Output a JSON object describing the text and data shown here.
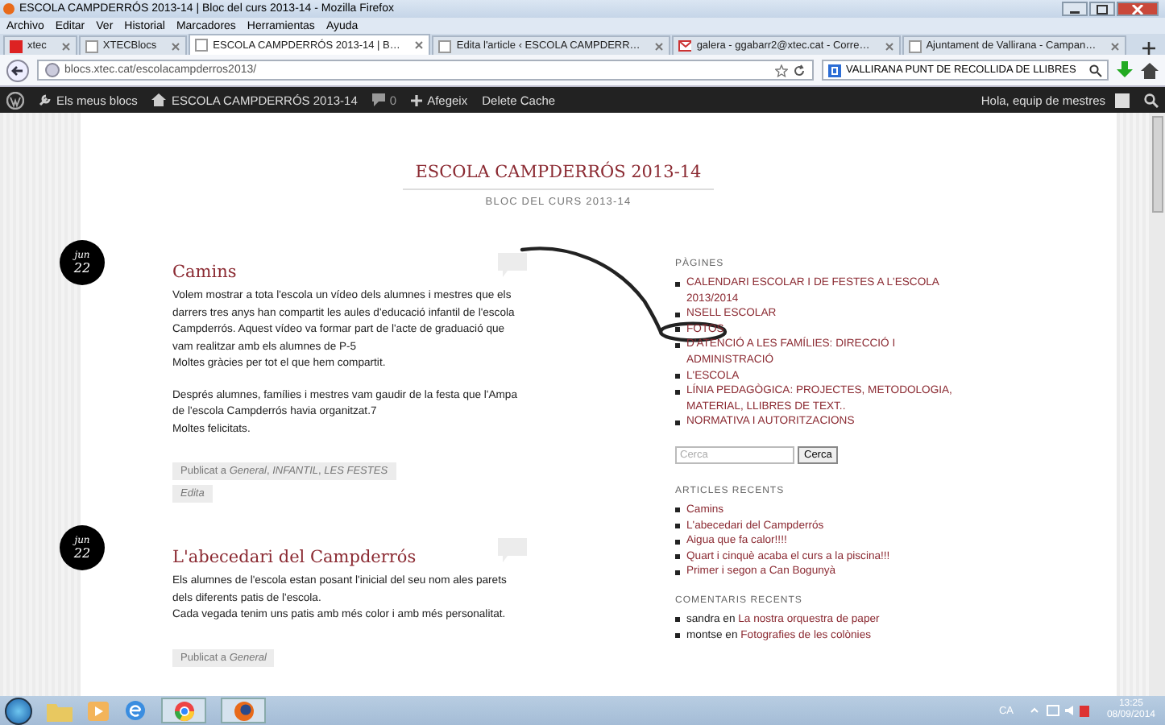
{
  "window": {
    "title": "ESCOLA CAMPDERRÓS 2013-14 | Bloc del curs 2013-14 - Mozilla Firefox"
  },
  "menu": [
    "Archivo",
    "Editar",
    "Ver",
    "Historial",
    "Marcadores",
    "Herramientas",
    "Ayuda"
  ],
  "tabs": [
    {
      "label": "xtec",
      "selected": false,
      "kind": "red"
    },
    {
      "label": "XTECBlocs",
      "selected": false,
      "kind": "page"
    },
    {
      "label": "ESCOLA CAMPDERRÓS 2013-14 | B…",
      "selected": true,
      "kind": "page"
    },
    {
      "label": "Edita l'article ‹ ESCOLA CAMPDERR…",
      "selected": false,
      "kind": "page"
    },
    {
      "label": "galera - ggabarr2@xtec.cat - Corre…",
      "selected": false,
      "kind": "mail"
    },
    {
      "label": "Ajuntament de Vallirana - Campan…",
      "selected": false,
      "kind": "page"
    }
  ],
  "address": {
    "url": "blocs.xtec.cat/escolacampderros2013/"
  },
  "search": {
    "value": "VALLIRANA PUNT DE RECOLLIDA DE LLIBRES"
  },
  "admin_bar": {
    "my_blogs": "Els meus blocs",
    "site": "ESCOLA CAMPDERRÓS 2013-14",
    "comments": "0",
    "add": "Afegeix",
    "cache": "Delete Cache",
    "greeting": "Hola, equip de mestres"
  },
  "blog": {
    "title": "ESCOLA CAMPDERRÓS 2013-14",
    "subtitle": "BLOC DEL CURS 2013-14"
  },
  "posts": [
    {
      "month": "jun",
      "day": "22",
      "title": "Camins",
      "paragraphs": [
        [
          "Volem mostrar a tota l'escola un vídeo dels alumnes i mestres que els darrers tres anys han compartit les aules d'educació infantil de l'escola Campderrós. Aquest vídeo va formar part de l'acte de graduació que vam realitzar amb els alumnes de P-5",
          "Moltes gràcies per tot el que hem compartit."
        ],
        [
          "Després alumnes, famílies i mestres vam gaudir de la festa que l'Ampa de l'escola Campderrós havia organitzat.7",
          "Moltes felicitats."
        ]
      ],
      "categories": "Publicat a *General*, *INFANTIL*, *LES FESTES*",
      "edit": "Edita"
    },
    {
      "month": "jun",
      "day": "22",
      "title": "L'abecedari del Campderrós",
      "paragraphs": [
        [
          "Els alumnes de l'escola estan posant l'inicial del seu nom ales parets dels diferents patis de l'escola.",
          "Cada vegada tenim uns patis amb més color i amb més personalitat."
        ]
      ],
      "categories": "Publicat a *General*"
    }
  ],
  "sidebar": {
    "pages_heading": "PÀGINES",
    "pages": [
      "CALENDARI ESCOLAR I DE FESTES A L'ESCOLA 2013/2014",
      "NSELL ESCOLAR",
      "FOTOS",
      "D'ATENCIÓ A LES FAMÍLIES: DIRECCIÓ I ADMINISTRACIÓ",
      "L'ESCOLA",
      "LÍNIA PEDAGÒGICA: PROJECTES, METODOLOGIA, MATERIAL, LLIBRES DE TEXT..",
      "NORMATIVA I AUTORITZACIONS"
    ],
    "search_placeholder": "Cerca",
    "search_button": "Cerca",
    "recent_heading": "ARTICLES RECENTS",
    "recent": [
      "Camins",
      "L'abecedari del Campderrós",
      "Aigua que fa calor!!!!",
      "Quart i cinquè acaba el curs a la piscina!!!",
      "Primer i segon a Can Bogunyà"
    ],
    "comments_heading": "COMENTARIS RECENTS",
    "comments": [
      {
        "author": "sandra",
        "joiner": "en",
        "post": "La nostra orquestra de paper"
      },
      {
        "author": "montse",
        "joiner": "en",
        "post": "Fotografies de les colònies"
      }
    ]
  },
  "taskbar": {
    "language": "CA",
    "time": "13:25",
    "date": "08/09/2014"
  }
}
